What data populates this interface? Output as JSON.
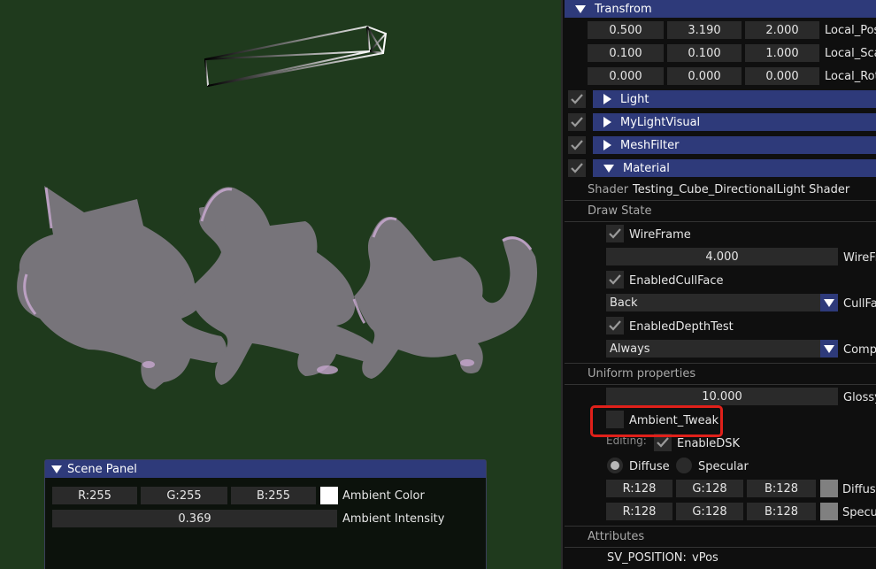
{
  "inspector": {
    "transform": {
      "header": "Transfrom",
      "rows": [
        {
          "values": [
            "0.500",
            "3.190",
            "2.000"
          ],
          "label": "Local_Pos"
        },
        {
          "values": [
            "0.100",
            "0.100",
            "1.000"
          ],
          "label": "Local_Sca"
        },
        {
          "values": [
            "0.000",
            "0.000",
            "0.000"
          ],
          "label": "Local_Rot"
        }
      ]
    },
    "components": [
      {
        "label": "Light"
      },
      {
        "label": "MyLightVisual"
      },
      {
        "label": "MeshFilter"
      },
      {
        "label": "Material"
      }
    ],
    "material": {
      "shader_key": "Shader",
      "shader_value": "Testing_Cube_DirectionalLight Shader",
      "draw_state_title": "Draw State",
      "wireframe_label": "WireFrame",
      "wireframe_width": "4.000",
      "wireframe_width_label": "WireFr",
      "cullface_label": "EnabledCullFace",
      "cull_value": "Back",
      "cull_label": "CullFa",
      "depthtest_label": "EnabledDepthTest",
      "compare_value": "Always",
      "compare_label": "Compa",
      "uniform_title": "Uniform properties",
      "glossy_value": "10.000",
      "glossy_label": "Glossy",
      "ambient_tweak_label": "Ambient_Tweak",
      "editing_label": "Editing:",
      "enable_dsk_label": "EnableDSK",
      "diffuse_label": "Diffuse",
      "specular_label": "Specular",
      "diffuse_color": {
        "r": "R:128",
        "g": "G:128",
        "b": "B:128",
        "label": "Diffuse",
        "swatch": "#808080"
      },
      "specular_color": {
        "r": "R:128",
        "g": "G:128",
        "b": "B:128",
        "label": "Specu",
        "swatch": "#808080"
      },
      "attributes_title": "Attributes",
      "attr_key": "SV_POSITION:",
      "attr_value": "vPos"
    }
  },
  "scene_panel": {
    "title": "Scene Panel",
    "ambient_color": {
      "r": "R:255",
      "g": "G:255",
      "b": "B:255",
      "label": "Ambient Color",
      "swatch": "#ffffff"
    },
    "ambient_intensity": {
      "value": "0.369",
      "label": "Ambient Intensity"
    }
  },
  "colors": {
    "viewport_bg": "#1f3a1d",
    "header_blue": "#2e3a7a",
    "highlight_red": "#e0201a",
    "mesh_gray": "#77747a"
  },
  "icons": [
    "checkmark-icon",
    "triangle-right-icon",
    "triangle-down-icon",
    "dropdown-arrow-icon",
    "light-gizmo-icon"
  ]
}
